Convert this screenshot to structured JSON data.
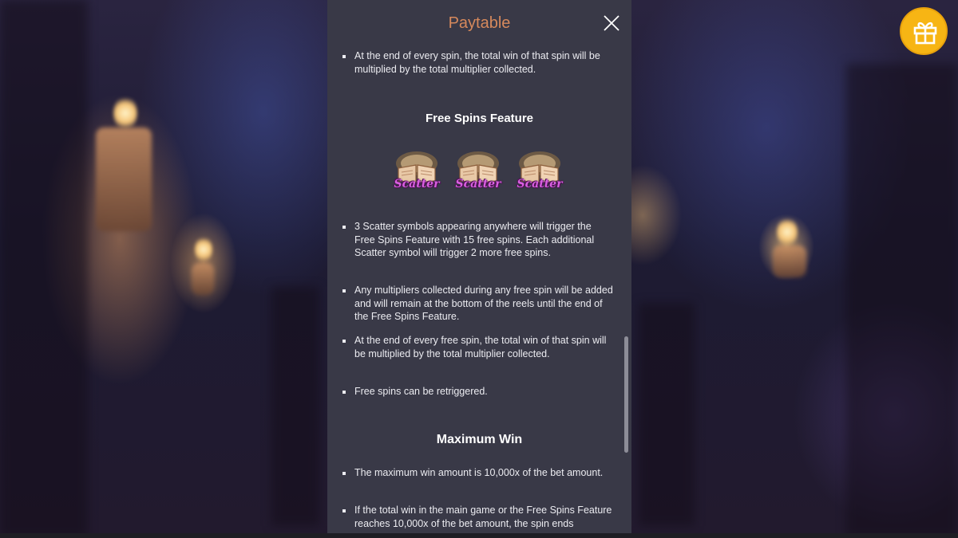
{
  "panel": {
    "title": "Paytable"
  },
  "top_bullet": "At the end of every spin, the total win of that spin will be multiplied by the total multiplier collected.",
  "free_spins": {
    "title": "Free Spins Feature",
    "symbol_label": "Scatter",
    "symbol_count": 3,
    "bullets": [
      "3 Scatter symbols appearing anywhere will trigger the Free Spins Feature with 15 free spins. Each additional Scatter symbol will trigger 2 more free spins.",
      "Any multipliers collected during any free spin will be added and will remain at the bottom of the reels until the end of the Free Spins Feature.",
      "At the end of every free spin, the total win of that spin will be multiplied by the total multiplier collected.",
      "Free spins can be retriggered."
    ]
  },
  "maximum_win": {
    "title": "Maximum Win",
    "bullets": [
      "The maximum win amount is 10,000x of the bet amount.",
      "If the total win in the main game or the Free Spins Feature reaches 10,000x of the bet amount, the spin ends"
    ]
  },
  "icons": {
    "close": "close-icon",
    "gift": "gift-icon",
    "scatter": "scatter-book-icon"
  },
  "colors": {
    "panel_bg": "#393947",
    "title": "#d6895c",
    "gift": "#f7b514",
    "scatter_text": "#d85fe0"
  }
}
